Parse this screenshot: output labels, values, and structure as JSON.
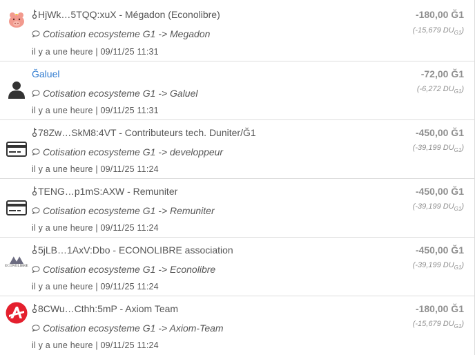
{
  "transactions": [
    {
      "avatar": "piggy-bank-icon",
      "title": "HjWk…5TQQ:xuX - Mégadon (Econolibre)",
      "has_key": true,
      "comment": "Cotisation ecosysteme G1 -> Megadon",
      "date": "il y a une heure | 09/11/25 11:31",
      "amount": "-180,00 Ğ1",
      "amount_du": "(-15,679 DU",
      "du_sub": "G1",
      "du_close": ")"
    },
    {
      "avatar": "user-silhouette-icon",
      "title": "Ğaluel",
      "has_key": false,
      "comment": "Cotisation ecosysteme G1 -> Galuel",
      "date": "il y a une heure | 09/11/25 11:31",
      "amount": "-72,00 Ğ1",
      "amount_du": "(-6,272 DU",
      "du_sub": "G1",
      "du_close": ")"
    },
    {
      "avatar": "credit-card-icon",
      "title": "78Zw…SkM8:4VT - Contributeurs tech. Duniter/Ğ1",
      "has_key": true,
      "comment": "Cotisation ecosysteme G1 -> developpeur",
      "date": "il y a une heure | 09/11/25 11:24",
      "amount": "-450,00 Ğ1",
      "amount_du": "(-39,199 DU",
      "du_sub": "G1",
      "du_close": ")"
    },
    {
      "avatar": "credit-card-icon",
      "title": "TENG…p1mS:AXW - Remuniter",
      "has_key": true,
      "comment": "Cotisation ecosysteme G1 -> Remuniter",
      "date": "il y a une heure | 09/11/25 11:24",
      "amount": "-450,00 Ğ1",
      "amount_du": "(-39,199 DU",
      "du_sub": "G1",
      "du_close": ")"
    },
    {
      "avatar": "econolibre-logo",
      "logo_text": "ECONOLIBRE",
      "title": "5jLB…1AxV:Dbo - ECONOLIBRE association",
      "has_key": true,
      "comment": "Cotisation ecosysteme G1 -> Econolibre",
      "date": "il y a une heure | 09/11/25 11:24",
      "amount": "-450,00 Ğ1",
      "amount_du": "(-39,199 DU",
      "du_sub": "G1",
      "du_close": ")"
    },
    {
      "avatar": "axiom-logo",
      "title": "8CWu…Cthh:5mP - Axiom Team",
      "has_key": true,
      "comment": "Cotisation ecosysteme G1 -> Axiom-Team",
      "date": "il y a une heure | 09/11/25 11:24",
      "amount": "-180,00 Ğ1",
      "amount_du": "(-15,679 DU",
      "du_sub": "G1",
      "du_close": ")"
    }
  ],
  "colors": {
    "member_link": "#2f7bd0",
    "amount_grey": "#8f8f8f",
    "axiom_red": "#e4202e",
    "piggy_pink": "#f29a8e"
  }
}
